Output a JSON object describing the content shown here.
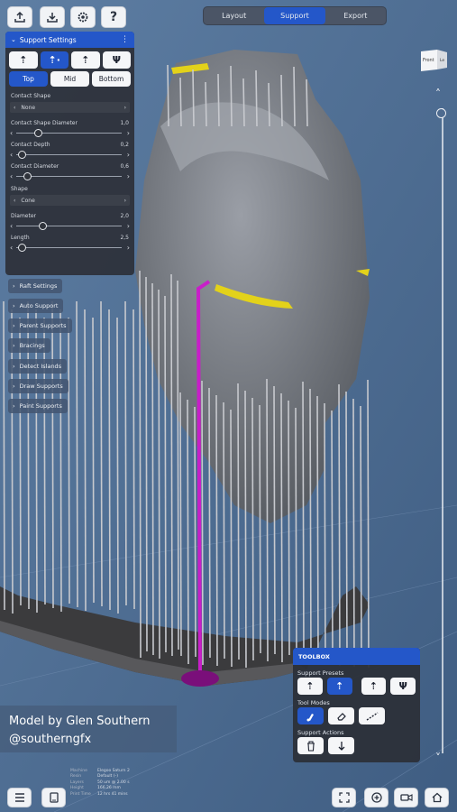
{
  "toolbar": {
    "icons": [
      "upload-icon",
      "download-icon",
      "settings-icon",
      "help-icon"
    ],
    "help_label": "?"
  },
  "tabs": [
    {
      "label": "Layout",
      "active": false
    },
    {
      "label": "Support",
      "active": true
    },
    {
      "label": "Export",
      "active": false
    }
  ],
  "support_settings": {
    "title": "Support Settings",
    "presets": [
      "light-support-icon",
      "medium-support-icon",
      "heavy-support-icon",
      "tree-support-icon"
    ],
    "placement_tabs": [
      {
        "label": "Top",
        "active": true
      },
      {
        "label": "Mid",
        "active": false
      },
      {
        "label": "Bottom",
        "active": false
      }
    ],
    "contact_shape_label": "Contact Shape",
    "contact_shape_value": "None",
    "contact_shape_diameter_label": "Contact Shape Diameter",
    "contact_shape_diameter_value": "1,0",
    "contact_shape_diameter_level": 0.2,
    "contact_depth_label": "Contact Depth",
    "contact_depth_value": "0,2",
    "contact_depth_level": 0.05,
    "contact_diameter_label": "Contact Diameter",
    "contact_diameter_value": "0,6",
    "contact_diameter_level": 0.1,
    "shape_label": "Shape",
    "shape_value": "Cone",
    "diameter_label": "Diameter",
    "diameter_value": "2,0",
    "diameter_level": 0.25,
    "length_label": "Length",
    "length_value": "2,5",
    "length_level": 0.05
  },
  "sections": [
    "Raft Settings",
    "Auto Support",
    "Parent Supports",
    "Bracings",
    "Detect Islands",
    "Draw Supports",
    "Paint Supports"
  ],
  "view_cube": {
    "front": "Front",
    "side": "Le"
  },
  "credit": {
    "line1": "Model by Glen Southern",
    "line2": "@southerngfx"
  },
  "machine_info": [
    {
      "key": "Machine",
      "value": "Elegoo Saturn 2"
    },
    {
      "key": "Resin",
      "value": "Default (-)"
    },
    {
      "key": "Layers",
      "value": "50 um @ 2.00 s"
    },
    {
      "key": "Height",
      "value": "166.26 mm"
    },
    {
      "key": "Print Time",
      "value": "12 hrs 41 mins"
    }
  ],
  "toolbox": {
    "title": "TOOLBOX",
    "support_presets_label": "Support Presets",
    "tool_modes_label": "Tool Modes",
    "support_actions_label": "Support Actions",
    "presets": [
      "light-support-icon",
      "medium-support-icon",
      "heavy-support-icon",
      "tree-support-icon"
    ],
    "modes": [
      "add-support-icon",
      "eraser-icon",
      "line-support-icon"
    ],
    "actions": [
      "delete-icon",
      "drop-down-icon"
    ]
  },
  "bottom_bar": [
    "menu-icon",
    "tablet-icon",
    "fit-view-icon",
    "zoom-add-icon",
    "camera-icon",
    "home-icon"
  ],
  "colors": {
    "accent": "#2457c9",
    "highlight_support": "#c81ec8",
    "island_marker": "#e3d21a",
    "background": "#4f6f93"
  }
}
